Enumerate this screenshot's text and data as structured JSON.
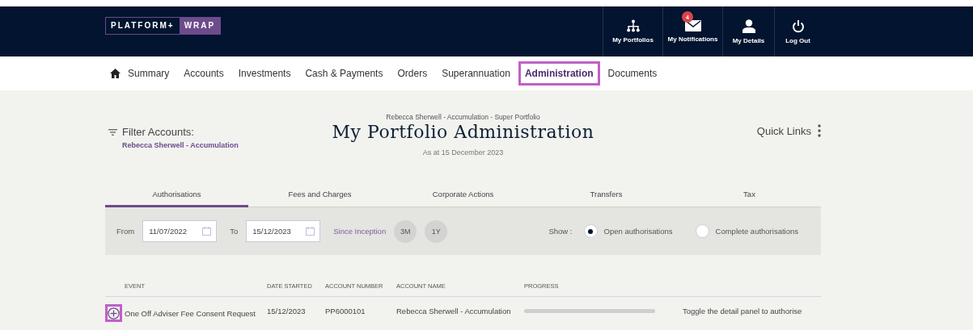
{
  "header": {
    "logo": {
      "left": "PLATFORM+",
      "right": "WRAP"
    },
    "actions": [
      {
        "kind": "portfolios",
        "label": "My Portfolios"
      },
      {
        "kind": "notifications",
        "label": "My Notifications",
        "badge": "4"
      },
      {
        "kind": "details",
        "label": "My Details"
      },
      {
        "kind": "logout",
        "label": "Log Out"
      }
    ]
  },
  "nav": [
    {
      "label": "Summary",
      "selected": false
    },
    {
      "label": "Accounts",
      "selected": false
    },
    {
      "label": "Investments",
      "selected": false
    },
    {
      "label": "Cash & Payments",
      "selected": false
    },
    {
      "label": "Orders",
      "selected": false
    },
    {
      "label": "Superannuation",
      "selected": false
    },
    {
      "label": "Administration",
      "selected": true
    },
    {
      "label": "Documents",
      "selected": false
    }
  ],
  "filter": {
    "label": "Filter Accounts:",
    "value": "Rebecca Sherwell - Accumulation"
  },
  "title": {
    "subtitle": "Rebecca Sherwell - Accumulation - Super Portfolio",
    "heading": "My Portfolio Administration",
    "as_at": "As at  15 December 2023"
  },
  "quick_links": "Quick Links",
  "tabs": [
    {
      "label": "Authorisations",
      "selected": true
    },
    {
      "label": "Fees and Charges",
      "selected": false
    },
    {
      "label": "Corporate Actions",
      "selected": false
    },
    {
      "label": "Transfers",
      "selected": false
    },
    {
      "label": "Tax",
      "selected": false
    }
  ],
  "toolbar": {
    "from_label": "From",
    "from": "11/07/2022",
    "to_label": "To",
    "to": "15/12/2023",
    "since_inception": "Since Inception",
    "periods": [
      "3M",
      "1Y"
    ],
    "show_label": "Show :",
    "options": [
      {
        "label": "Open authorisations",
        "selected": true
      },
      {
        "label": "Complete authorisations",
        "selected": false
      }
    ]
  },
  "table": {
    "columns": [
      "EVENT",
      "DATE STARTED",
      "ACCOUNT NUMBER",
      "ACCOUNT NAME",
      "PROGRESS"
    ],
    "rows": [
      {
        "event": "One Off Adviser Fee Consent Request",
        "date_started": "15/12/2023",
        "account_number": "PP6000101",
        "account_name": "Rebecca Sherwell - Accumulation",
        "status": "Toggle the detail panel to authorise",
        "expanded": false
      }
    ]
  }
}
